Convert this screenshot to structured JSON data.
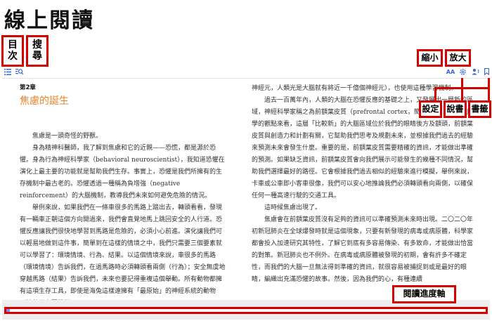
{
  "page": {
    "title": "線上閱讀"
  },
  "annotations": {
    "toc": "目次",
    "search": "搜尋",
    "zoom_out": "縮小",
    "zoom_in": "放大",
    "settings": "設定",
    "read_aloud": "說書",
    "bookmark": "書籤",
    "progress": "閱讀進度軸"
  },
  "toolbar": {
    "left_icons": [
      "list-icon",
      "search-icon"
    ],
    "right_icons": [
      "font-size-icon",
      "settings-icon",
      "read-aloud-icon",
      "bookmark-icon"
    ],
    "font_label": "AA"
  },
  "book": {
    "chapter": "第2章",
    "chapter_title": "焦慮的誕生",
    "left_paragraphs": [
      "焦慮是一頭奇怪的野獸。",
      "身為精神科醫師，我了解到焦慮和它的近親——恐慌，都是源於恐懼。身為行為神經科學家（behavioral neuroscientist），我知道恐懼在演化上最主要的功能就是幫助我們生存。事實上，恐懼是我們所擁有的生存機制中最古老的。恐懼透過一種稱為負增強（negative reinforcement）的大腦機制，教導我們未來如何避免危險的情況。",
      "舉例來說，如果我們在一條車很多的馬路上踏出去，轉頭看看，發現有一輛車正朝這個方向開過來，我們會直覺地馬上跳回安全的人行道。恐懼反應讓我們很快地學習到馬路是危險的，必須小心前進。演化讓我們可以輕易地做到這件事，簡單到在這樣的情境之中，我們只需要三個要素就可以學習了：環境情境、行為、結果。以這個情境來說，車很多的馬路（環境情境）告訴我們，在過馬路時必須轉頭看兩側（行為）；安全無虞地穿越馬路（結果）告訴我們，未來也要記得重複這個舉動。所有動物都擁有這項生存工具，即使是海兔這樣遠擁有「最原始」的神經系統的動物（總共只有兩萬個"
    ],
    "right_paragraphs": [
      "神經元，人類光是大腦就有將近一千億個神經元），也使用這種學習機制。",
      "過去一百萬年內，人類的大腦在恐懼反應的基礎之上，又發展出一層新的區域，神經科學家稱之為前額葉皮質（prefrontal cortex，簡稱PFC）。從解剖學的觀點來看，這層「比較新」的大腦區域位於我們的眼睛後方及額頭，前額葉皮質與創造力和計劃有關，它幫助我們思考及規劃未來，並根據我們過去的經驗來預測未來會發生什麼。重要的是，前額葉皮質需要精確的資訊，才能做出準確的預測。如果缺乏資訊，前額葉皮質會向我們展示可能發生的幾種不同情況，幫助我們選擇最好的路徑。它會根據我們過去相似的經驗來進行模擬，舉例來說，卡車或公車即小客車很像，我們可以安心地推論我們必須轉頭看向兩側，以確保任何一種高速行駛的交通工具。",
      "這時候焦慮出現了。",
      "焦慮會在前額葉皮質沒有足夠的資訊可以準確預測未來時出現。二〇二〇年初新冠肺炎在全球爆發時就是這個現象，只要有新發現的病毒或病原體，科學家都會投入加速研究其特性，了解它到底有多容易傳染、有多致命，才能做出恰當的對策。新冠肺炎也不例外。在病毒或病原體被發現的初期，會有許多不確定性，而我們的大腦一旦無法得到準確的資訊，就很容易被捕捉到或是最好的眼睛，編織出充滿恐懼的故事。然後，因為我們的心，有種連續"
    ]
  },
  "progress": {
    "fraction": 0.008
  },
  "colors": {
    "accent": "#d40000",
    "link_blue": "#3a63d3",
    "chapter_orange": "#e8832a",
    "progress_fill": "#7c8cf2"
  }
}
